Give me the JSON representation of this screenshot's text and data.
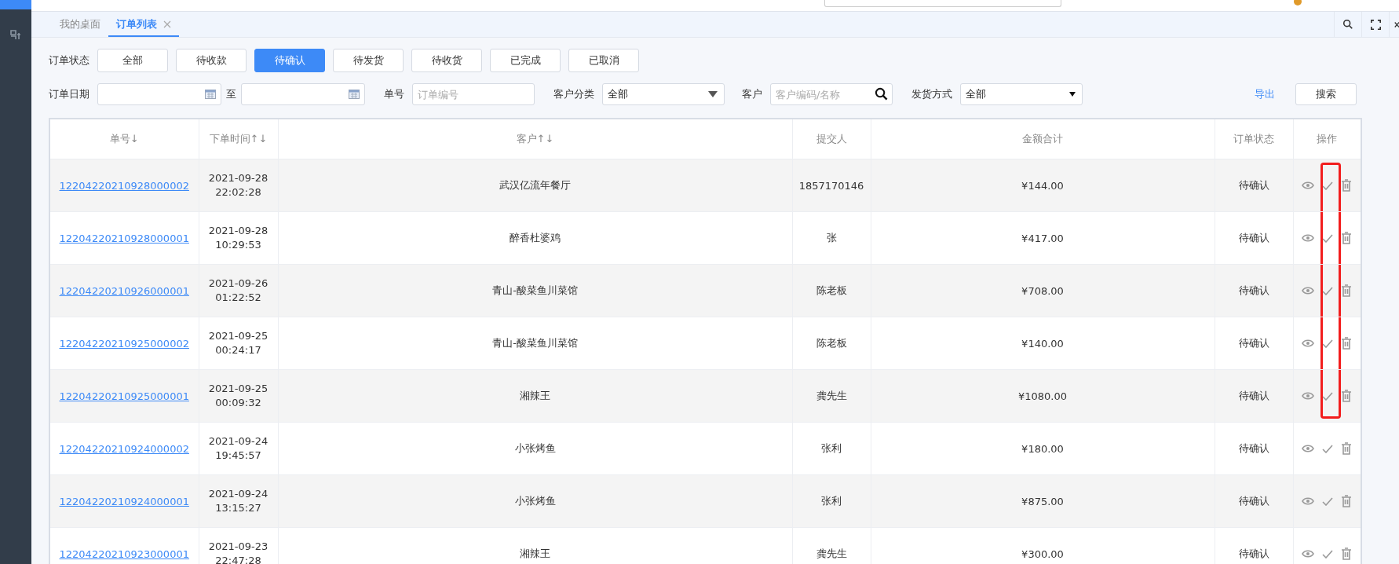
{
  "tabs": [
    {
      "label": "我的桌面",
      "selected": false,
      "closable": false
    },
    {
      "label": "订单列表",
      "selected": true,
      "closable": true
    }
  ],
  "status_filter": {
    "label": "订单状态",
    "options": [
      {
        "label": "全部",
        "selected": false
      },
      {
        "label": "待收款",
        "selected": false
      },
      {
        "label": "待确认",
        "selected": true
      },
      {
        "label": "待发货",
        "selected": false
      },
      {
        "label": "待收货",
        "selected": false
      },
      {
        "label": "已完成",
        "selected": false
      },
      {
        "label": "已取消",
        "selected": false
      }
    ]
  },
  "filters": {
    "date_label": "订单日期",
    "date_to": "至",
    "order_no_label": "单号",
    "order_no_placeholder": "订单编号",
    "category_label": "客户分类",
    "category_value": "全部",
    "customer_label": "客户",
    "customer_placeholder": "客户编码/名称",
    "shipping_label": "发货方式",
    "shipping_value": "全部",
    "export": "导出",
    "search": "搜索"
  },
  "table": {
    "columns": [
      {
        "label": "单号",
        "sort": "↓"
      },
      {
        "label": "下单时间",
        "sort": "↑↓"
      },
      {
        "label": "客户",
        "sort": "↑↓"
      },
      {
        "label": "提交人"
      },
      {
        "label": "金额合计"
      },
      {
        "label": "订单状态"
      },
      {
        "label": "操作"
      }
    ],
    "rows": [
      {
        "order_no": "12204220210928000002",
        "date": "2021-09-28",
        "time": "22:02:28",
        "customer": "武汉亿流年餐厅",
        "submitter": "1857170146",
        "amount": "¥144.00",
        "status": "待确认",
        "marked": true
      },
      {
        "order_no": "12204220210928000001",
        "date": "2021-09-28",
        "time": "10:29:53",
        "customer": "醉香杜婆鸡",
        "submitter": "张",
        "amount": "¥417.00",
        "status": "待确认",
        "marked": true
      },
      {
        "order_no": "12204220210926000001",
        "date": "2021-09-26",
        "time": "01:22:52",
        "customer": "青山-酸菜鱼川菜馆",
        "submitter": "陈老板",
        "amount": "¥708.00",
        "status": "待确认",
        "marked": true
      },
      {
        "order_no": "12204220210925000002",
        "date": "2021-09-25",
        "time": "00:24:17",
        "customer": "青山-酸菜鱼川菜馆",
        "submitter": "陈老板",
        "amount": "¥140.00",
        "status": "待确认",
        "marked": true
      },
      {
        "order_no": "12204220210925000001",
        "date": "2021-09-25",
        "time": "00:09:32",
        "customer": "湘辣王",
        "submitter": "龚先生",
        "amount": "¥1080.00",
        "status": "待确认",
        "marked": true
      },
      {
        "order_no": "12204220210924000002",
        "date": "2021-09-24",
        "time": "19:45:57",
        "customer": "小张烤鱼",
        "submitter": "张利",
        "amount": "¥180.00",
        "status": "待确认",
        "marked": false
      },
      {
        "order_no": "12204220210924000001",
        "date": "2021-09-24",
        "time": "13:15:27",
        "customer": "小张烤鱼",
        "submitter": "张利",
        "amount": "¥875.00",
        "status": "待确认",
        "marked": false
      },
      {
        "order_no": "12204220210923000001",
        "date": "2021-09-23",
        "time": "22:47:28",
        "customer": "湘辣王",
        "submitter": "龚先生",
        "amount": "¥300.00",
        "status": "待确认",
        "marked": false
      }
    ]
  }
}
